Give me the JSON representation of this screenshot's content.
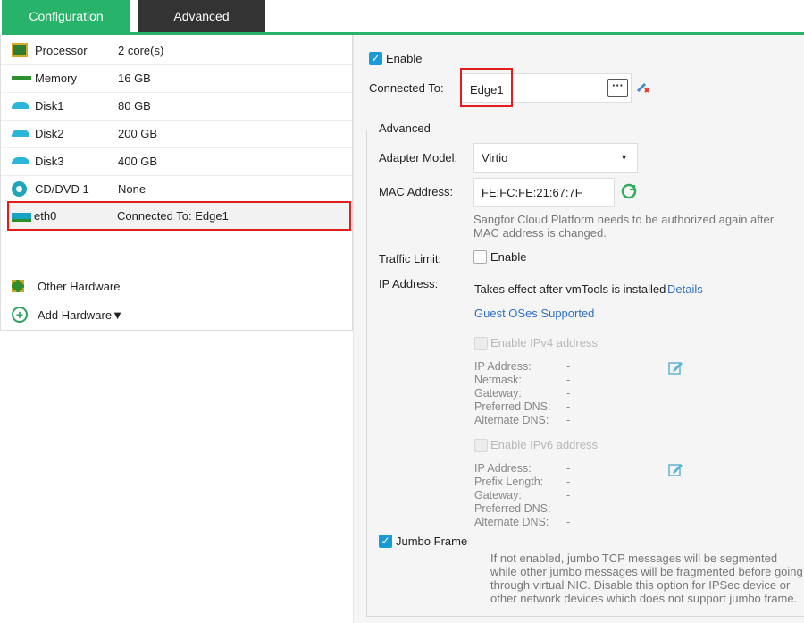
{
  "tabs": {
    "configuration": "Configuration",
    "advanced": "Advanced"
  },
  "hardware": {
    "processor": {
      "name": "Processor",
      "value": "2 core(s)"
    },
    "memory": {
      "name": "Memory",
      "value": "16 GB"
    },
    "disk1": {
      "name": "Disk1",
      "value": "80 GB"
    },
    "disk2": {
      "name": "Disk2",
      "value": "200 GB"
    },
    "disk3": {
      "name": "Disk3",
      "value": "400 GB"
    },
    "cddvd": {
      "name": "CD/DVD 1",
      "value": "None"
    },
    "eth0": {
      "name": "eth0",
      "value": "Connected To: Edge1"
    },
    "other": "Other Hardware",
    "add": "Add Hardware▼"
  },
  "nic": {
    "enable_label": "Enable",
    "connected_to_label": "Connected To:",
    "connected_to_value": "Edge1",
    "advanced_legend": "Advanced",
    "adapter_model_label": "Adapter Model:",
    "adapter_model_value": "Virtio",
    "mac_label": "MAC Address:",
    "mac_value": "FE:FC:FE:21:67:7F",
    "mac_note": "Sangfor Cloud Platform needs to be authorized again after MAC address is changed.",
    "traffic_limit_label": "Traffic Limit:",
    "traffic_enable_label": "Enable",
    "ip_address_label": "IP Address:",
    "ip_takes_effect": "Takes effect after vmTools is installed",
    "details_link": "Details",
    "guest_os_link": "Guest OSes Supported",
    "ipv4": {
      "enable_label": "Enable IPv4 address",
      "ip": "IP Address:",
      "netmask": "Netmask:",
      "gateway": "Gateway:",
      "pref_dns": "Preferred DNS:",
      "alt_dns": "Alternate DNS:",
      "dash": "-"
    },
    "ipv6": {
      "enable_label": "Enable IPv6 address",
      "ip": "IP Address:",
      "prefix": "Prefix Length:",
      "gateway": "Gateway:",
      "pref_dns": "Preferred DNS:",
      "alt_dns": "Alternate DNS:",
      "dash": "-"
    },
    "jumbo_label": "Jumbo Frame",
    "jumbo_note": "If not enabled, jumbo TCP messages will be segmented while other jumbo messages will be fragmented before going through virtual NIC. Disable this option for IPSec device or other network devices which does not support jumbo frame."
  }
}
